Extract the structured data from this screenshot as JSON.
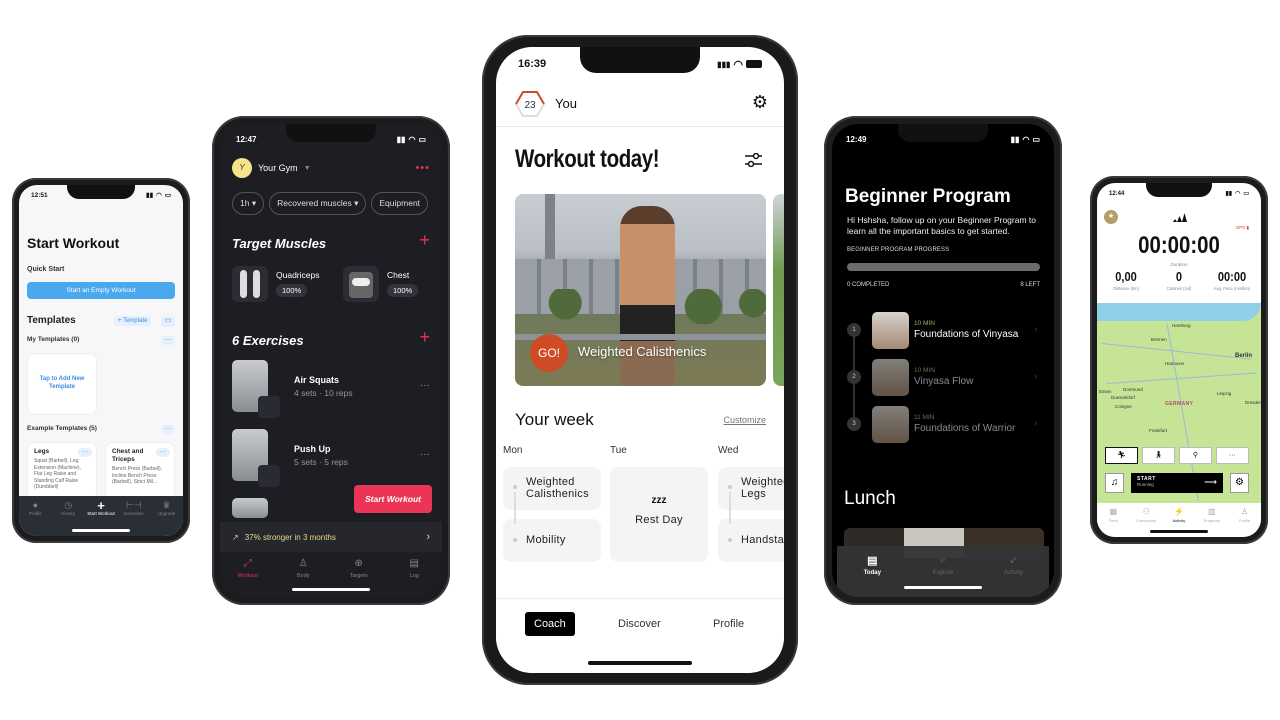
{
  "phone1": {
    "time": "12:51",
    "title": "Start Workout",
    "quick_start": "Quick Start",
    "empty_workout_button": "Start an Empty Workout",
    "templates_heading": "Templates",
    "add_template_button": "+ Template",
    "folder_icon": "folder-icon",
    "my_templates": "My Templates (0)",
    "add_template_card": "Tap to Add New Template",
    "example_templates": "Example Templates (5)",
    "cards": [
      {
        "title": "Legs",
        "desc": "Squat (Barbell), Leg Extension (Machine), Flat Leg Raise and Standing Calf Raise (Dumbbell)"
      },
      {
        "title": "Chest and Triceps",
        "desc": "Bench Press (Barbell), Incline Bench Press (Barbell), Strict Mil..."
      }
    ],
    "tabs": [
      {
        "label": "Profile",
        "icon": "person-icon"
      },
      {
        "label": "History",
        "icon": "clock-icon"
      },
      {
        "label": "Start Workout",
        "icon": "plus-icon"
      },
      {
        "label": "Exercises",
        "icon": "dumbbell-icon"
      },
      {
        "label": "Upgrade",
        "icon": "crown-icon"
      }
    ],
    "active_tab": "Start Workout"
  },
  "phone2": {
    "time": "12:47",
    "gym_initial": "Y",
    "gym_name": "Your Gym",
    "filters": [
      "1h",
      "Recovered muscles",
      "Equipment"
    ],
    "target_heading": "Target Muscles",
    "muscles": [
      {
        "name": "Quadriceps",
        "pct": "100%"
      },
      {
        "name": "Chest",
        "pct": "100%"
      }
    ],
    "exercises_heading": "6 Exercises",
    "exercises": [
      {
        "name": "Air Squats",
        "detail": "4 sets · 10 reps"
      },
      {
        "name": "Push Up",
        "detail": "5 sets · 5 reps"
      }
    ],
    "start_button": "Start Workout",
    "stronger_text": "37% stronger in 3 months",
    "tabs": [
      {
        "label": "Workout",
        "icon": "dumbbell-icon"
      },
      {
        "label": "Body",
        "icon": "body-icon"
      },
      {
        "label": "Targets",
        "icon": "target-icon"
      },
      {
        "label": "Log",
        "icon": "calendar-icon"
      }
    ],
    "active_tab": "Workout",
    "accent": "#e8334f"
  },
  "phone3": {
    "time": "16:39",
    "level": "23",
    "user": "You",
    "title": "Workout today!",
    "go_label": "GO!",
    "hero_workout": "Weighted Calisthenics",
    "week_heading": "Your week",
    "customize": "Customize",
    "days": [
      {
        "day": "Mon",
        "items": [
          "Weighted Calisthenics",
          "Mobility"
        ]
      },
      {
        "day": "Tue",
        "rest": "Rest Day",
        "rest_icon": "zzz"
      },
      {
        "day": "Wed",
        "items": [
          "Weighted Legs",
          "Handstand"
        ]
      }
    ],
    "nav": [
      "Coach",
      "Discover",
      "Profile"
    ],
    "active_nav": "Coach",
    "accent": "#cf4b25"
  },
  "phone4": {
    "time": "12:49",
    "title": "Beginner Program",
    "description": "Hi Hshsha, follow up on your Beginner Program to learn all the important basics to get started.",
    "progress_label": "BEGINNER PROGRAM PROGRESS",
    "progress_value": 0,
    "completed": "0 COMPLETED",
    "left": "8 LEFT",
    "lessons": [
      {
        "num": "1",
        "duration": "10 MIN",
        "name": "Foundations of Vinyasa"
      },
      {
        "num": "2",
        "duration": "10 MIN",
        "name": "Vinyasa Flow"
      },
      {
        "num": "3",
        "duration": "11 MIN",
        "name": "Foundations of Warrior"
      }
    ],
    "section2": "Lunch",
    "tabs": [
      {
        "label": "Today",
        "icon": "today-icon"
      },
      {
        "label": "Explore",
        "icon": "search-icon"
      },
      {
        "label": "Activity",
        "icon": "check-circle-icon"
      }
    ],
    "active_tab": "Today"
  },
  "phone5": {
    "time": "12:44",
    "gps": "GPS",
    "duration": "00:00:00",
    "duration_label": "Duration",
    "stats": [
      {
        "value": "0,00",
        "label": "Distance (km)"
      },
      {
        "value": "0",
        "label": "Calories (cal)"
      },
      {
        "value": "00:00",
        "label": "Avg. Pace (min/km)"
      }
    ],
    "map": {
      "cities": [
        "Hamburg",
        "Bremen",
        "Berlin",
        "Hannover",
        "Essen",
        "Dortmund",
        "Duesseldorf",
        "Cologne",
        "Leipzig",
        "Dresden",
        "Frankfurt"
      ],
      "country": "GERMANY"
    },
    "activities": [
      "running-icon",
      "walking-icon",
      "cycling-icon",
      "more-icon"
    ],
    "start_label": "START",
    "start_sub": "Running",
    "feed_badge": "1",
    "tabs": [
      {
        "label": "Feed",
        "icon": "feed-icon"
      },
      {
        "label": "Community",
        "icon": "community-icon"
      },
      {
        "label": "Activity",
        "icon": "activity-icon"
      },
      {
        "label": "Progress",
        "icon": "progress-icon"
      },
      {
        "label": "Profile",
        "icon": "profile-icon"
      }
    ],
    "active_tab": "Activity"
  }
}
